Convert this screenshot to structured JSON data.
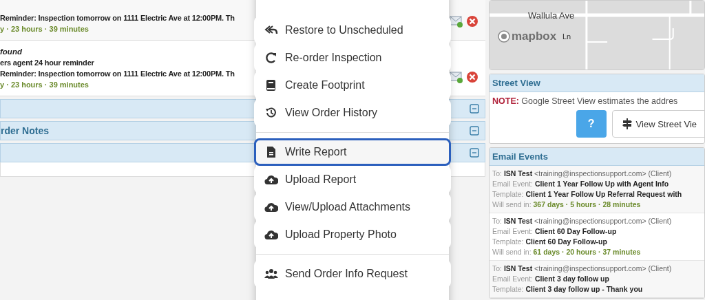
{
  "reminders": [
    {
      "subject": "Reminder: Inspection tomorrow on 1111 Electric Ave at 12:00PM. Th",
      "send_in": "y · 23 hours · 39 minutes"
    },
    {
      "status": "found",
      "recipient": "ers agent 24 hour reminder",
      "subject": "Reminder: Inspection tomorrow on 1111 Electric Ave at 12:00PM. Th",
      "send_in": "y · 23 hours · 39 minutes"
    }
  ],
  "panels": [
    {
      "expanded": true
    },
    {
      "title": "rder Notes",
      "expanded": true
    },
    {
      "expanded": true
    }
  ],
  "menu": {
    "groups": [
      [
        {
          "label": "Restore to Unscheduled",
          "selected": false
        },
        {
          "label": "Re-order Inspection",
          "selected": false
        },
        {
          "label": "Create Footprint",
          "selected": false
        },
        {
          "label": "View Order History",
          "selected": false
        }
      ],
      [
        {
          "label": "Write Report",
          "selected": true
        },
        {
          "label": "Upload Report",
          "selected": false
        },
        {
          "label": "View/Upload Attachments",
          "selected": false
        },
        {
          "label": "Upload Property Photo",
          "selected": false
        }
      ],
      [
        {
          "label": "Send Order Info Request",
          "selected": false
        }
      ]
    ]
  },
  "map": {
    "street_labels": [
      "Wallula Ave",
      "Ln"
    ],
    "logo": "mapbox"
  },
  "street_view": {
    "title": "Street View",
    "note_label": "NOTE:",
    "note": "Google Street View estimates the addres",
    "help_button": "?",
    "view_button": "View Street Vie"
  },
  "email_events": {
    "title": "Email Events",
    "events": [
      {
        "to_label": "To:",
        "name": "ISN Test",
        "address": "<training@inspectionsupport.com> (Client)",
        "event_label": "Email Event:",
        "event": "Client 1 Year Follow Up with Agent Info",
        "template_label": "Template:",
        "template": "Client 1 Year Follow Up Referral Request with",
        "send_label": "Will send in:",
        "send_in": "367 days · 5 hours · 28 minutes"
      },
      {
        "to_label": "To:",
        "name": "ISN Test",
        "address": "<training@inspectionsupport.com> (Client)",
        "event_label": "Email Event:",
        "event": "Client 60 Day Follow-up",
        "template_label": "Template:",
        "template": "Client 60 Day Follow-up",
        "send_label": "Will send in:",
        "send_in": "61 days · 20 hours · 37 minutes"
      },
      {
        "to_label": "To:",
        "name": "ISN Test",
        "address": "<training@inspectionsupport.com> (Client)",
        "event_label": "Email Event:",
        "event": "Client 3 day follow up",
        "template_label": "Template:",
        "template": "Client 3 day follow up - Thank you"
      }
    ]
  }
}
